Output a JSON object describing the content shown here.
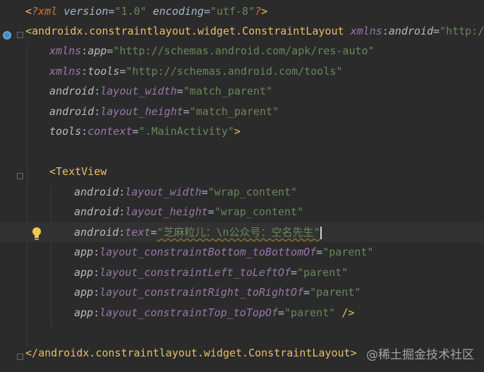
{
  "lines": [
    {
      "parts": [
        [
          "b",
          "<"
        ],
        [
          "pi",
          "?xml "
        ],
        [
          "pit",
          "version"
        ],
        [
          "eq",
          "="
        ],
        [
          "s",
          "\"1.0\""
        ],
        [
          "pit",
          " encoding"
        ],
        [
          "eq",
          "="
        ],
        [
          "s",
          "\"utf-8\""
        ],
        [
          "pi",
          "?"
        ],
        [
          "b",
          ">"
        ]
      ]
    },
    {
      "parts": [
        [
          "b",
          "<"
        ],
        [
          "t",
          "androidx.constraintlayout.widget.ConstraintLayout"
        ],
        [
          "plain",
          " "
        ],
        [
          "ns",
          "xmlns"
        ],
        [
          "eq",
          ":"
        ],
        [
          "at",
          "android"
        ],
        [
          "eq",
          "="
        ],
        [
          "s",
          "\"http://sc"
        ]
      ]
    },
    {
      "parts": [
        [
          "ns",
          "xmlns"
        ],
        [
          "eq",
          ":"
        ],
        [
          "at",
          "app"
        ],
        [
          "eq",
          "="
        ],
        [
          "s",
          "\"http://schemas.android.com/apk/res-auto\""
        ]
      ]
    },
    {
      "parts": [
        [
          "ns",
          "xmlns"
        ],
        [
          "eq",
          ":"
        ],
        [
          "at",
          "tools"
        ],
        [
          "eq",
          "="
        ],
        [
          "s",
          "\"http://schemas.android.com/tools\""
        ]
      ]
    },
    {
      "parts": [
        [
          "at",
          "android"
        ],
        [
          "eq",
          ":"
        ],
        [
          "ns",
          "layout_width"
        ],
        [
          "eq",
          "="
        ],
        [
          "s",
          "\"match_parent\""
        ]
      ]
    },
    {
      "parts": [
        [
          "at",
          "android"
        ],
        [
          "eq",
          ":"
        ],
        [
          "ns",
          "layout_height"
        ],
        [
          "eq",
          "="
        ],
        [
          "s",
          "\"match_parent\""
        ]
      ]
    },
    {
      "parts": [
        [
          "at",
          "tools"
        ],
        [
          "eq",
          ":"
        ],
        [
          "ns",
          "context"
        ],
        [
          "eq",
          "="
        ],
        [
          "s",
          "\".MainActivity\""
        ],
        [
          "b",
          ">"
        ]
      ]
    },
    {
      "parts": []
    },
    {
      "parts": [
        [
          "b",
          "<"
        ],
        [
          "t",
          "TextView"
        ]
      ]
    },
    {
      "parts": [
        [
          "at",
          "android"
        ],
        [
          "eq",
          ":"
        ],
        [
          "ns",
          "layout_width"
        ],
        [
          "eq",
          "="
        ],
        [
          "s",
          "\"wrap_content\""
        ]
      ]
    },
    {
      "parts": [
        [
          "at",
          "android"
        ],
        [
          "eq",
          ":"
        ],
        [
          "ns",
          "layout_height"
        ],
        [
          "eq",
          "="
        ],
        [
          "s",
          "\"wrap_content\""
        ]
      ]
    },
    {
      "parts": [
        [
          "at",
          "android"
        ],
        [
          "eq",
          ":"
        ],
        [
          "ns",
          "text"
        ],
        [
          "eq",
          "="
        ],
        [
          "s",
          "\"芝麻粒儿：\\n公众号：空名先生\""
        ]
      ]
    },
    {
      "parts": [
        [
          "at",
          "app"
        ],
        [
          "eq",
          ":"
        ],
        [
          "ns",
          "layout_constraintBottom_toBottomOf"
        ],
        [
          "eq",
          "="
        ],
        [
          "s",
          "\"parent\""
        ]
      ]
    },
    {
      "parts": [
        [
          "at",
          "app"
        ],
        [
          "eq",
          ":"
        ],
        [
          "ns",
          "layout_constraintLeft_toLeftOf"
        ],
        [
          "eq",
          "="
        ],
        [
          "s",
          "\"parent\""
        ]
      ]
    },
    {
      "parts": [
        [
          "at",
          "app"
        ],
        [
          "eq",
          ":"
        ],
        [
          "ns",
          "layout_constraintRight_toRightOf"
        ],
        [
          "eq",
          "="
        ],
        [
          "s",
          "\"parent\""
        ]
      ]
    },
    {
      "parts": [
        [
          "at",
          "app"
        ],
        [
          "eq",
          ":"
        ],
        [
          "ns",
          "layout_constraintTop_toTopOf"
        ],
        [
          "eq",
          "="
        ],
        [
          "s",
          "\"parent\""
        ],
        [
          "plain",
          " "
        ],
        [
          "b",
          "/>"
        ]
      ]
    },
    {
      "parts": []
    },
    {
      "parts": [
        [
          "b",
          "</"
        ],
        [
          "t",
          "androidx.constraintlayout.widget.ConstraintLayout"
        ],
        [
          "b",
          ">"
        ]
      ]
    }
  ],
  "watermark": "@稀土掘金技术社区",
  "icons": {
    "gutter_marker": "android-layout-icon",
    "intention": "lightbulb-icon"
  },
  "colors": {
    "background": "#2b2b2b",
    "tag": "#e8bf6a",
    "string": "#6a8759",
    "attribute": "#9876aa"
  }
}
